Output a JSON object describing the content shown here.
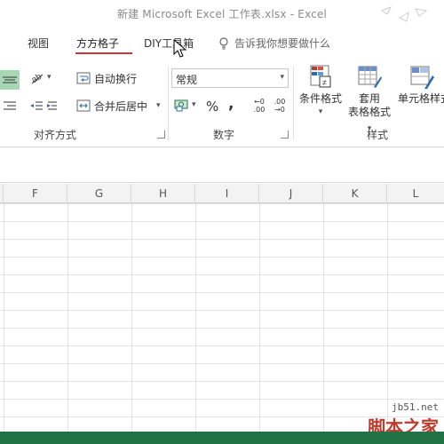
{
  "window": {
    "title": "新建 Microsoft Excel 工作表.xlsx - Excel"
  },
  "tabs": [
    {
      "label": "视图"
    },
    {
      "label": "方方格子",
      "active": true
    },
    {
      "label": "DIY工具箱"
    }
  ],
  "tell_me": {
    "label": "告诉我你想要做什么"
  },
  "ribbon": {
    "alignment": {
      "group_label": "对齐方式",
      "wrap_text": "自动换行",
      "merge_center": "合并后居中"
    },
    "number": {
      "group_label": "数字",
      "format_value": "常规",
      "percent_symbol": "%",
      "comma_symbol": ",",
      "increase_decimal_top": "←0",
      "increase_decimal_bottom": ".00",
      "decrease_decimal_top": ".00",
      "decrease_decimal_bottom": "→0"
    },
    "styles": {
      "group_label": "样式",
      "conditional_format": "条件格式",
      "format_table_line1": "套用",
      "format_table_line2": "表格格式",
      "cell_styles": "单元格样式"
    }
  },
  "columns": [
    "F",
    "G",
    "H",
    "I",
    "J",
    "K",
    "L"
  ],
  "watermark": {
    "url": "jb51.net",
    "name": "脚本之家"
  },
  "colors": {
    "accent": "#d13438",
    "statusbar": "#217346",
    "selected_green": "#a7d7b4"
  }
}
